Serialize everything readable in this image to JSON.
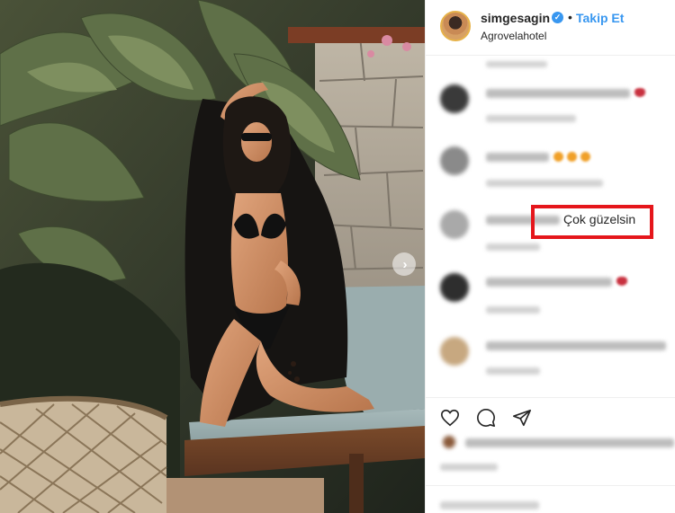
{
  "post": {
    "author": "simgesagin",
    "follow_label": "Takip Et",
    "separator": "•",
    "location": "Agrovelahotel",
    "highlighted_comment": "Çok güzelsin",
    "next_icon": "chevron-right-icon",
    "verified_icon": "verified-badge-icon"
  },
  "actions": {
    "icons": [
      "heart-icon",
      "comment-icon",
      "share-icon"
    ]
  },
  "colors": {
    "link": "#3897f0",
    "highlight": "#e5161b",
    "text": "#262626"
  }
}
